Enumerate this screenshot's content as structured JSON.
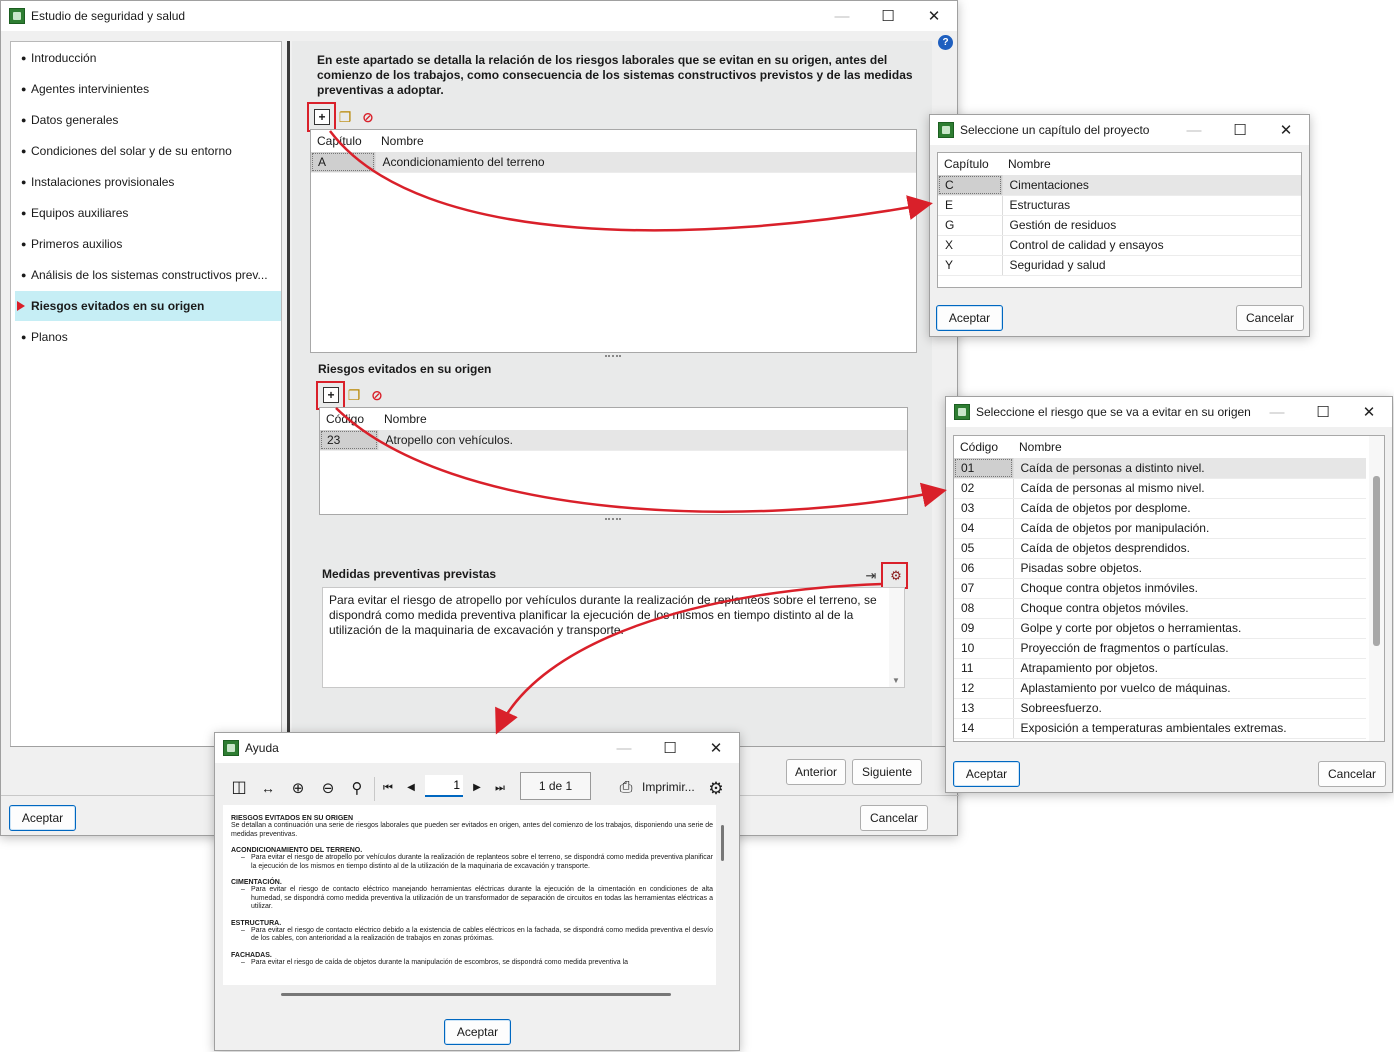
{
  "main_window": {
    "title": "Estudio de seguridad y salud",
    "nav_items": [
      {
        "label": "Introducción"
      },
      {
        "label": "Agentes intervinientes"
      },
      {
        "label": "Datos generales"
      },
      {
        "label": "Condiciones del solar y de su entorno"
      },
      {
        "label": "Instalaciones provisionales"
      },
      {
        "label": "Equipos auxiliares"
      },
      {
        "label": "Primeros auxilios"
      },
      {
        "label": "Análisis de los sistemas constructivos prev..."
      },
      {
        "label": "Riesgos evitados en su origen"
      },
      {
        "label": "Planos"
      }
    ],
    "active_item": "Riesgos evitados en su origen",
    "intro_text": "En este apartado se detalla la relación de los riesgos laborales que se evitan en su origen, antes del comienzo de los trabajos, como consecuencia de los sistemas constructivos previstos y de las medidas preventivas a adoptar.",
    "chapters_table": {
      "headers": [
        "Capítulo",
        "Nombre"
      ],
      "rows": [
        {
          "code": "A",
          "name": "Acondicionamiento del terreno"
        }
      ]
    },
    "risks_section_label": "Riesgos evitados en su origen",
    "risks_table": {
      "headers": [
        "Código",
        "Nombre"
      ],
      "rows": [
        {
          "code": "23",
          "name": "Atropello con vehículos."
        }
      ]
    },
    "measures_label": "Medidas preventivas previstas",
    "measures_text": "Para evitar el riesgo de atropello por vehículos durante la realización de replanteos sobre el terreno, se dispondrá como medida preventiva planificar la ejecución de los mismos en tiempo distinto al de la utilización de la maquinaria de excavación y transporte.",
    "buttons": {
      "prev": "Anterior",
      "next": "Siguiente",
      "accept": "Aceptar",
      "cancel": "Cancelar"
    }
  },
  "chapter_dialog": {
    "title": "Seleccione un capítulo del proyecto",
    "headers": [
      "Capítulo",
      "Nombre"
    ],
    "rows": [
      {
        "code": "C",
        "name": "Cimentaciones"
      },
      {
        "code": "E",
        "name": "Estructuras"
      },
      {
        "code": "G",
        "name": "Gestión de residuos"
      },
      {
        "code": "X",
        "name": "Control de calidad y ensayos"
      },
      {
        "code": "Y",
        "name": "Seguridad y salud"
      }
    ],
    "accept": "Aceptar",
    "cancel": "Cancelar"
  },
  "risk_dialog": {
    "title": "Seleccione el riesgo que se va a evitar en su origen",
    "headers": [
      "Código",
      "Nombre"
    ],
    "rows": [
      {
        "code": "01",
        "name": "Caída de personas a distinto nivel."
      },
      {
        "code": "02",
        "name": "Caída de personas al mismo nivel."
      },
      {
        "code": "03",
        "name": "Caída de objetos por desplome."
      },
      {
        "code": "04",
        "name": "Caída de objetos por manipulación."
      },
      {
        "code": "05",
        "name": "Caída de objetos desprendidos."
      },
      {
        "code": "06",
        "name": "Pisadas sobre objetos."
      },
      {
        "code": "07",
        "name": "Choque contra objetos inmóviles."
      },
      {
        "code": "08",
        "name": "Choque contra objetos móviles."
      },
      {
        "code": "09",
        "name": "Golpe y corte por objetos o herramientas."
      },
      {
        "code": "10",
        "name": "Proyección de fragmentos o partículas."
      },
      {
        "code": "11",
        "name": "Atrapamiento por objetos."
      },
      {
        "code": "12",
        "name": "Aplastamiento por vuelco de máquinas."
      },
      {
        "code": "13",
        "name": "Sobreesfuerzo."
      },
      {
        "code": "14",
        "name": "Exposición a temperaturas ambientales extremas."
      }
    ],
    "accept": "Aceptar",
    "cancel": "Cancelar"
  },
  "help_dialog": {
    "title": "Ayuda",
    "page_input": "1",
    "page_count": "1 de 1",
    "print_label": "Imprimir...",
    "accept": "Aceptar",
    "doc": {
      "h1": "RIESGOS EVITADOS EN SU ORIGEN",
      "p1": "Se detallan a continuación una serie de riesgos laborales que pueden ser evitados en origen, antes del comienzo de los trabajos, disponiendo una serie de medidas preventivas.",
      "h2": "ACONDICIONAMIENTO DEL TERRENO.",
      "li2": "Para evitar el riesgo de atropello por vehículos durante la realización de replanteos sobre el terreno, se dispondrá como medida preventiva planificar la ejecución de los mismos en tiempo distinto al de la utilización de la maquinaria de excavación y transporte.",
      "h3": "CIMENTACIÓN.",
      "li3": "Para evitar el riesgo de contacto eléctrico manejando herramientas eléctricas durante la ejecución de la cimentación en condiciones de alta humedad, se dispondrá como medida preventiva la utilización de un transformador de separación de circuitos en todas las herramientas eléctricas a utilizar.",
      "h4": "ESTRUCTURA.",
      "li4": "Para evitar el riesgo de contacto eléctrico debido a la existencia de cables eléctricos en la fachada, se dispondrá como medida preventiva el desvío de los cables, con anterioridad a la realización de trabajos en zonas próximas.",
      "h5": "FACHADAS.",
      "li5": "Para evitar el riesgo de caída de objetos durante la manipulación de escombros, se dispondrá como medida preventiva la"
    }
  },
  "icons": {
    "add": "add-row-icon",
    "copy": "copy-icon",
    "delete": "delete-icon",
    "help": "help-icon",
    "import": "import-text-icon",
    "library": "library-icon"
  },
  "colors": {
    "accent": "#0067c0",
    "highlight_box": "#d9202a",
    "active_nav": "#c6eef5"
  }
}
